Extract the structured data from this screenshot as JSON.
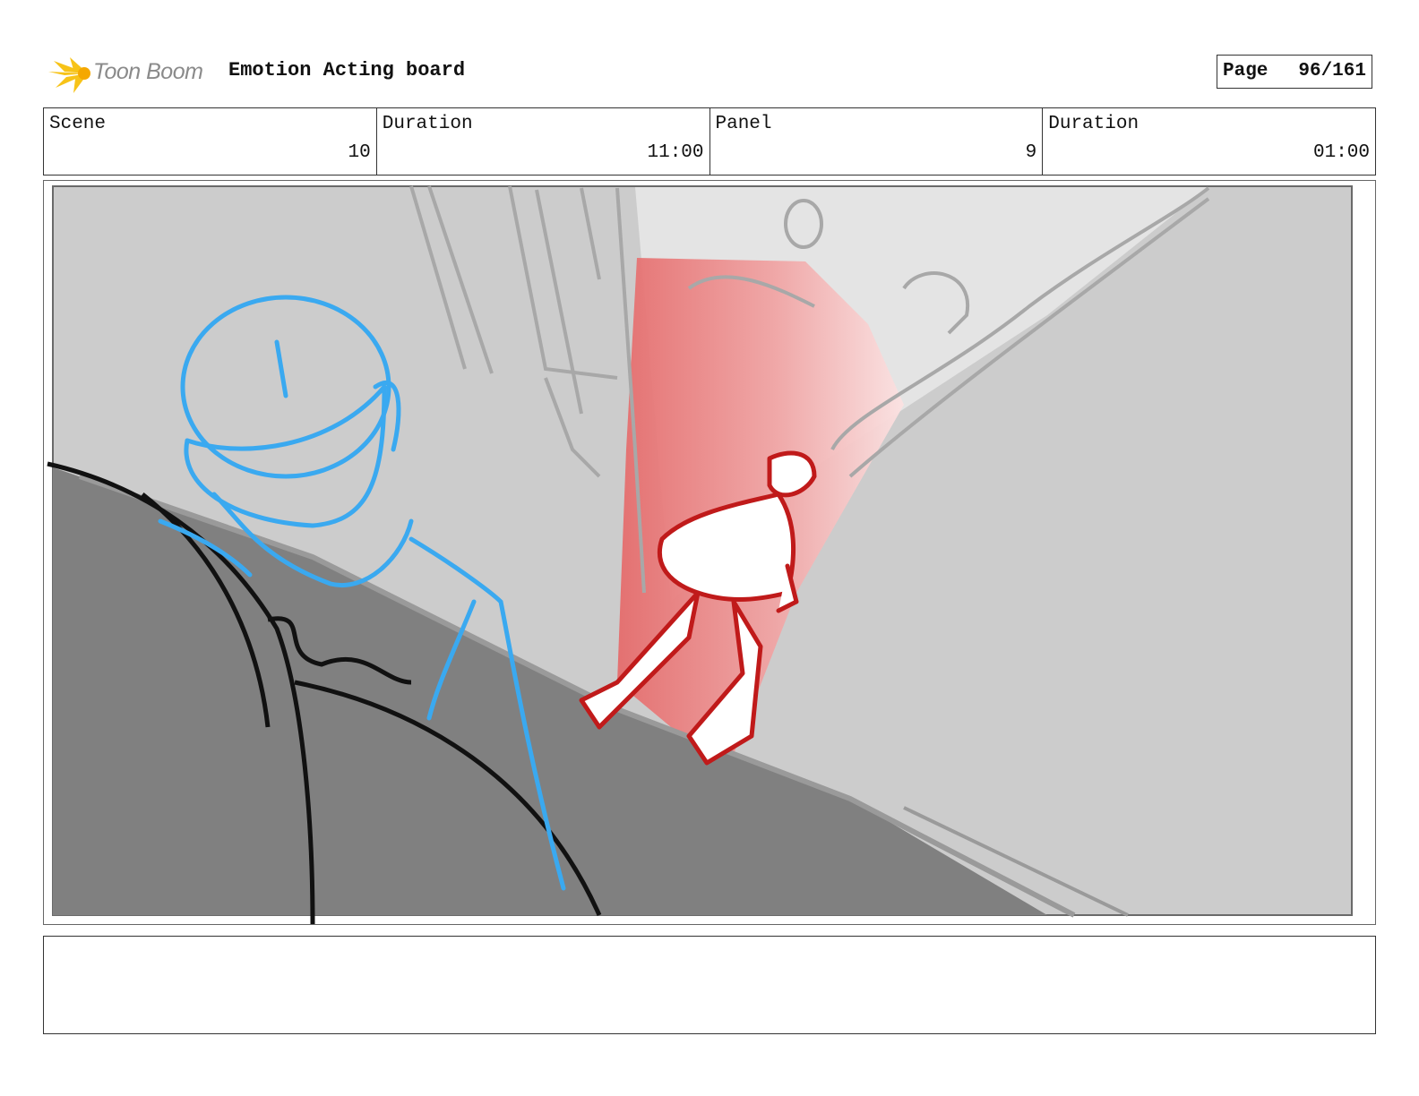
{
  "header": {
    "logo_text": "Toon Boom",
    "title": "Emotion Acting board",
    "page_label": "Page",
    "page_value": "96/161"
  },
  "info": {
    "scene_label": "Scene",
    "scene_value": "10",
    "duration_label": "Duration",
    "duration_value": "11:00",
    "panel_label": "Panel",
    "panel_value": "9",
    "panel_duration_label": "Duration",
    "panel_duration_value": "01:00"
  },
  "panel": {
    "image_description": "Storyboard sketch: over-the-shoulder view of a blue-outlined figure and black foreground shape, looking at a red figure walking up a sloped ramp into a red light",
    "colors": {
      "background": "#cccccc",
      "floor": "#808080",
      "light": "#e56c6c",
      "foreground_figure": "#3aa9f0",
      "red_figure": "#c01a1a",
      "outline": "#111111"
    }
  },
  "notes": {
    "text": ""
  }
}
